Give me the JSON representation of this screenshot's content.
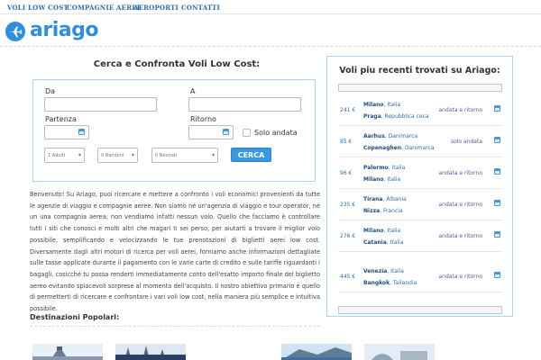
{
  "nav": {
    "items": [
      "VOLI LOW COST",
      "COMPAGNIE AEREE",
      "AEROPORTI",
      "CONTATTI"
    ]
  },
  "header": {
    "logo_text": "ariago",
    "brand_color": "#2f8ee0"
  },
  "search": {
    "title": "Cerca e Confronta Voli Low Cost:",
    "from_label": "Da",
    "to_label": "A",
    "departure_label": "Partenza",
    "return_label": "Ritorno",
    "oneway_label": "Solo andata",
    "adults": "1 Adulti",
    "children": "0 Bambini",
    "infants": "0 Neonati",
    "button_label": "CERCA"
  },
  "intro": "Benvenuto! Su Ariago, puoi ricercare e mettere a confronto i voli economici provenienti da tutte le agenzie di viaggio e compagnie aeree. Non siamo né un'agenzia di viaggio e tour operator, né un una compagnia aerea; non vendiamo infatti nessun volo. Quello che facciamo è controllare tutti i siti che conosci e molti altri che magari ti sei perso, per aiutarti a trovare il miglior volo possibile, semplificando e velocizzando le tue prenotazioni di biglietti aerei low cost. Diversamente dagli altri motori di ricerca per voli aerei, forniamo anche informazioni dettagliate sulle tasse applicate durante il pagamento con le varie carte di credito e sulle tariffe riguardanti i bagagli, cosicché tu possa renderti immediatamente conto dell'esatto importo finale del biglietto aereo evitando spiacevoli sorprese al momento dell'acquisto. Il nostro obiettivo primario è quello di permetterti di ricercare e confrontare i vari voli low cost, nella maniera più semplice e intuitiva possibile.",
  "destinations": {
    "title": "Destinazioni Popolari:"
  },
  "recent": {
    "title": "Voli piu recenti trovati su Ariago:",
    "rows": [
      {
        "price": "241 €",
        "from_city": "Milano",
        "from_country": "Italia",
        "to_city": "Praga",
        "to_country": "Repubblica ceca",
        "trip": "andata e ritorno"
      },
      {
        "price": "85 €",
        "from_city": "Aarhus",
        "from_country": "Danimarca",
        "to_city": "Copenaghen",
        "to_country": "Danimarca",
        "trip": "solo andata"
      },
      {
        "price": "96 €",
        "from_city": "Palermo",
        "from_country": "Italia",
        "to_city": "Milano",
        "to_country": "Italia",
        "trip": "andata e ritorno"
      },
      {
        "price": "235 €",
        "from_city": "Tirana",
        "from_country": "Albania",
        "to_city": "Nizza",
        "to_country": "Francia",
        "trip": "andata e ritorno"
      },
      {
        "price": "276 €",
        "from_city": "Milano",
        "from_country": "Italia",
        "to_city": "Catania",
        "to_country": "Italia",
        "trip": "andata e ritorno"
      },
      {
        "price": "445 €",
        "from_city": "Venezia",
        "from_country": "Italia",
        "to_city": "Bangkok",
        "to_country": "Tailandia",
        "trip": "andata e ritorno"
      }
    ]
  }
}
